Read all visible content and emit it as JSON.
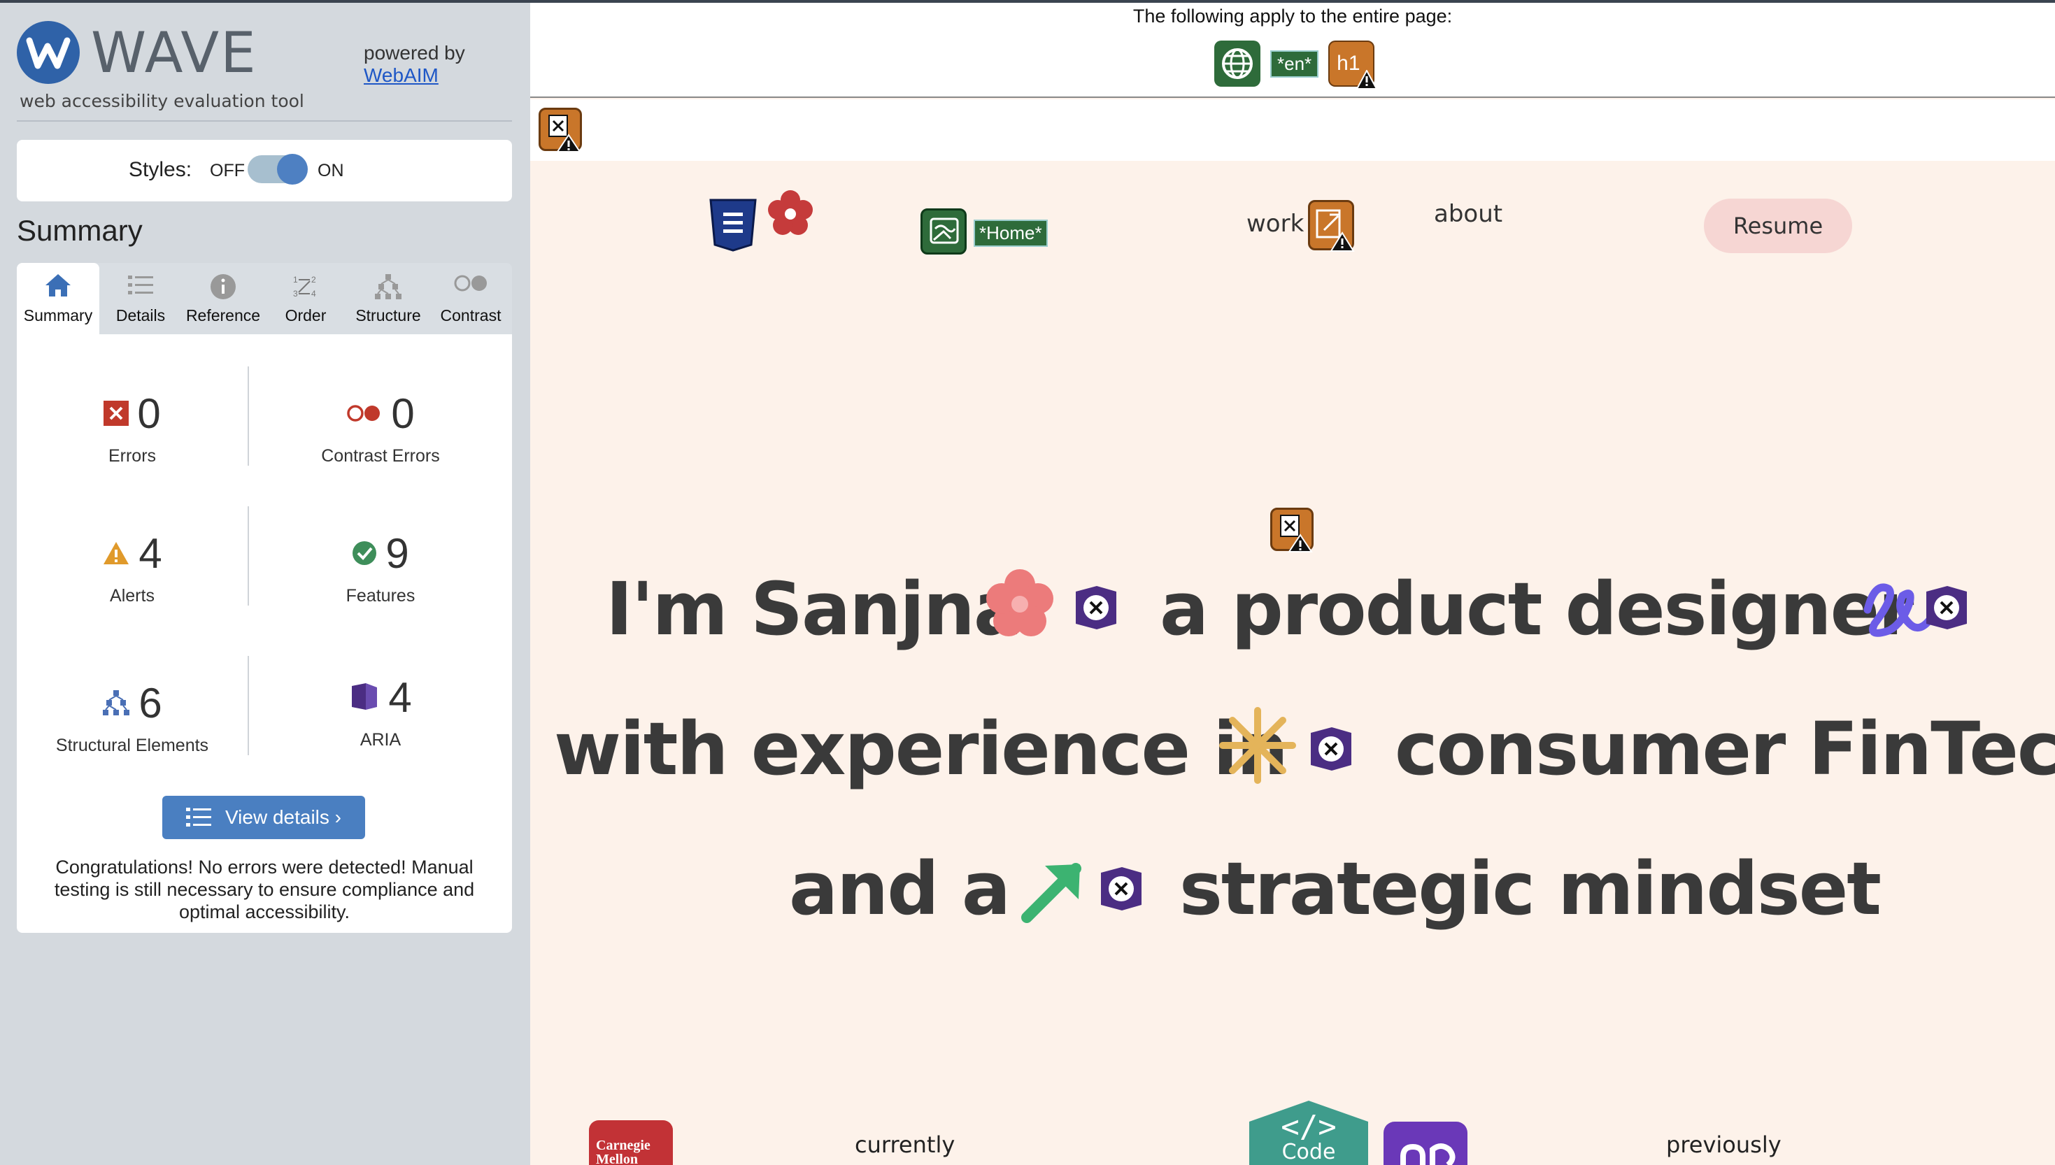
{
  "wave": {
    "title": "WAVE",
    "subtitle": "web accessibility evaluation tool",
    "powered_by": "powered by",
    "webaim_link": "WebAIM",
    "styles_label": "Styles:",
    "styles_off": "OFF",
    "styles_on": "ON",
    "summary_heading": "Summary",
    "tabs": [
      {
        "label": "Summary",
        "icon": "home-icon",
        "active": true
      },
      {
        "label": "Details",
        "icon": "list-icon",
        "active": false
      },
      {
        "label": "Reference",
        "icon": "info-icon",
        "active": false
      },
      {
        "label": "Order",
        "icon": "order-icon",
        "active": false
      },
      {
        "label": "Structure",
        "icon": "structure-icon",
        "active": false
      },
      {
        "label": "Contrast",
        "icon": "contrast-icon",
        "active": false
      }
    ],
    "stats": {
      "errors": {
        "count": "0",
        "label": "Errors",
        "color": "#c0392b"
      },
      "contrast_errors": {
        "count": "0",
        "label": "Contrast Errors",
        "color": "#c0392b"
      },
      "alerts": {
        "count": "4",
        "label": "Alerts",
        "color": "#e09a2b"
      },
      "features": {
        "count": "9",
        "label": "Features",
        "color": "#3e8e5a"
      },
      "structural": {
        "count": "6",
        "label": "Structural Elements",
        "color": "#4a6fb5"
      },
      "aria": {
        "count": "4",
        "label": "ARIA",
        "color": "#4b2d83"
      }
    },
    "view_details": "View details ›",
    "congrats": "Congratulations! No errors were detected! Manual testing is still necessary to ensure compliance and optimal accessibility."
  },
  "page": {
    "global_text": "The following apply to the entire page:",
    "lang_chip": "*en*",
    "h1_label": "h1",
    "home_chip": "*Home*",
    "nav": {
      "work": "work",
      "about": "about",
      "resume": "Resume"
    },
    "hero": {
      "line1a": "I'm Sanjna",
      "line1b": "a product designer",
      "line2a": "with experience in",
      "line2b": "consumer FinTech",
      "line3a": "and a",
      "line3b": "strategic mindset"
    },
    "bottom": {
      "currently": "currently",
      "previously": "previously",
      "code_badge": "Code",
      "cmu_badge": "Carnegie Mellon"
    }
  },
  "colors": {
    "page_bg": "#fdf2ea",
    "panel_bg": "#d4d9de",
    "wave_blue": "#2f62a8",
    "alert_orange": "#c9762a",
    "feature_green": "#2e6b3a",
    "aria_purple": "#4b2d83",
    "flower_pink": "#ec7b7b",
    "squiggle_purple": "#6c5ce7",
    "asterisk_gold": "#e4b45a",
    "arrow_green": "#3cb371"
  }
}
